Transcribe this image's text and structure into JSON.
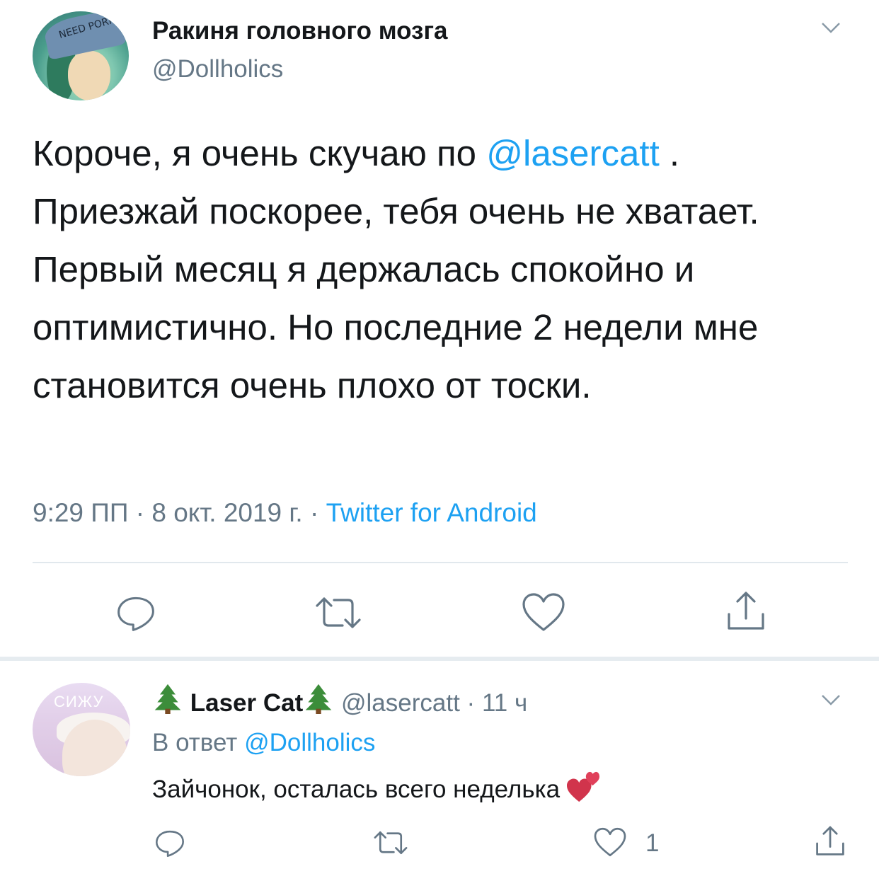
{
  "main_tweet": {
    "display_name": "Ракиня головного мозга",
    "handle": "@Dollholics",
    "avatar_caption": "NEED PORN",
    "text_before_mention": "Короче, я очень скучаю по ",
    "mention": "@lasercatt",
    "text_after_mention": " . Приезжай поскорее, тебя очень не хватает. Первый месяц я держалась спокойно и оптимистично. Но последние 2 недели мне становится очень плохо от тоски.",
    "time": "9:29 ПП",
    "date": "8 окт. 2019 г.",
    "separator": "·",
    "source": "Twitter for Android",
    "actions": [
      "reply-icon",
      "retweet-icon",
      "like-icon",
      "share-icon"
    ]
  },
  "reply_tweet": {
    "avatar_caption": "СИЖУ",
    "display_name": "Laser Cat",
    "handle": "@lasercatt",
    "age": "11 ч",
    "separator": "·",
    "in_reply_prefix": "В ответ",
    "in_reply_mention": "@Dollholics",
    "text": "Зайчонок, осталась всего неделька",
    "like_count": "1",
    "actions": [
      "reply-icon",
      "retweet-icon",
      "like-icon",
      "share-icon"
    ]
  },
  "colors": {
    "text": "#14171a",
    "secondary": "#657786",
    "link": "#1da1f2",
    "divider": "#e1e8ed"
  }
}
